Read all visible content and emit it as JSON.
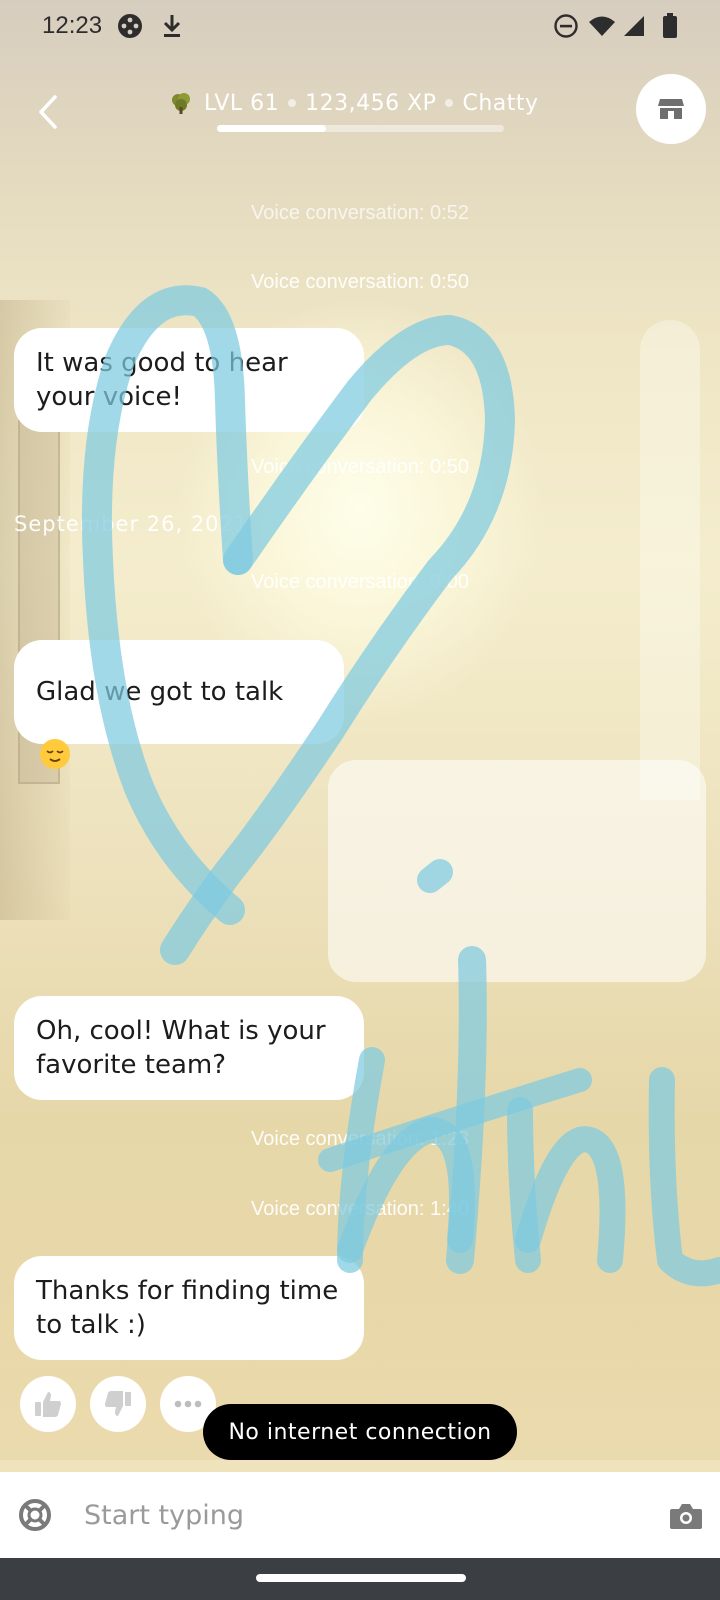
{
  "status_bar": {
    "time": "12:23",
    "left_icons": [
      "game-controller-icon",
      "download-icon"
    ],
    "right_icons": [
      "do-not-disturb-icon",
      "wifi-icon",
      "signal-icon",
      "battery-icon"
    ]
  },
  "header": {
    "level": "LVL 61",
    "xp": "123,456 XP",
    "status": "Chatty",
    "xp_progress_fraction": 0.38,
    "back_icon": "chevron-left-icon",
    "store_icon": "store-icon",
    "avatar_icon": "sprout-icon"
  },
  "chat": {
    "sys_voice_1": "Voice conversation: 0:52",
    "sys_voice_2": "Voice conversation: 0:50",
    "bubble_1": "It was good to hear your voice!",
    "sys_voice_3": "Voice conversation: 0:50",
    "date": "September 26, 2021",
    "sys_voice_4": "Voice conversation: 0:00",
    "bubble_2": "Glad we got to talk",
    "bubble_2_emoji": "relieved-face-emoji",
    "bubble_3": "Oh, cool! What is your favorite team?",
    "sys_voice_5": "Voice conversation: 1:23",
    "sys_voice_6": "Voice conversation: 1:40",
    "bubble_4": "Thanks for finding time to talk :)"
  },
  "reactions": {
    "like_icon": "thumbs-up-icon",
    "dislike_icon": "thumbs-down-icon",
    "more_icon": "more-horizontal-icon"
  },
  "toast": {
    "message": "No internet connection"
  },
  "composer": {
    "placeholder": "Start typing",
    "left_icon": "lifebuoy-icon",
    "camera_icon": "camera-icon"
  },
  "colors": {
    "scribble": "#7ecbe0",
    "toast_bg": "#000000",
    "bubble_bg": "#ffffff",
    "nav_bar": "#3b3f43"
  }
}
